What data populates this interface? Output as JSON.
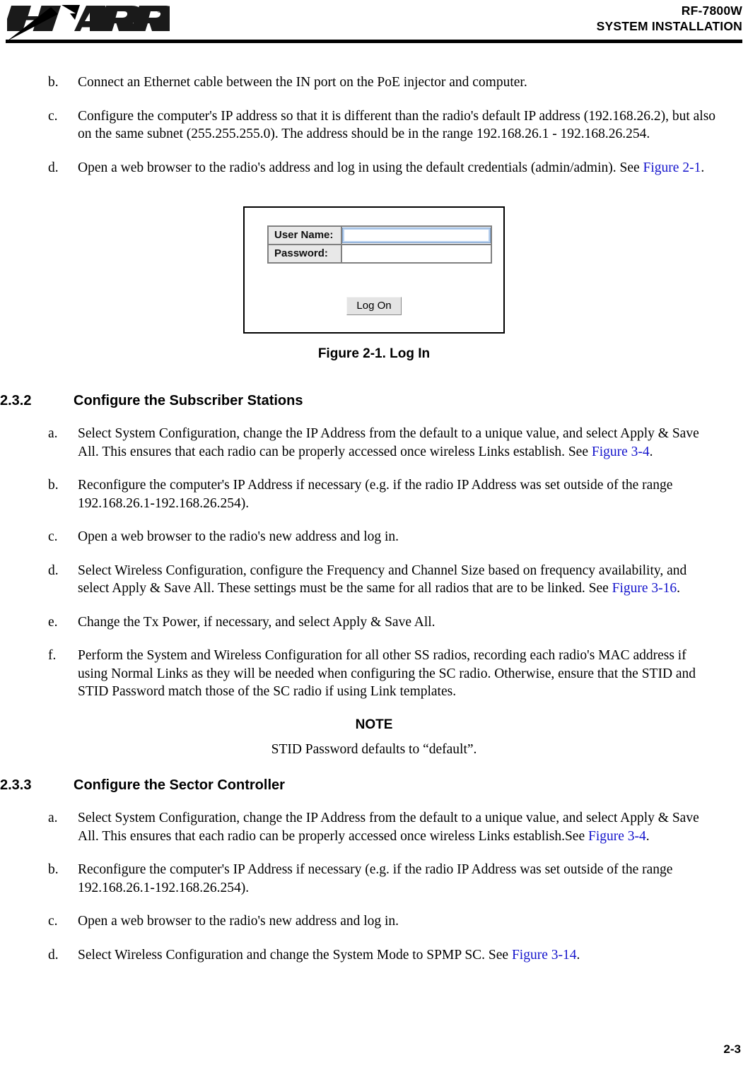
{
  "header": {
    "logo_alt": "HARRIS",
    "logo_text": "HARRIS",
    "registered_mark": "®",
    "product": "RF-7800W",
    "manual_title": "SYSTEM INSTALLATION"
  },
  "steps_top": [
    {
      "marker": "b.",
      "text": "Connect an Ethernet cable between the IN port on the PoE injector and computer."
    },
    {
      "marker": "c.",
      "text": "Configure the computer's IP address so that it is different than the radio's default IP address (192.168.26.2), but also on the same subnet (255.255.255.0). The address should be in the range 192.168.26.1 - 192.168.26.254."
    },
    {
      "marker": "d.",
      "text_before": "Open a web browser to the radio's address and log in using the default credentials (admin/admin). See ",
      "link": "Figure 2-1",
      "text_after": "."
    }
  ],
  "figure": {
    "username_label": "User Name:",
    "password_label": "Password:",
    "username_value": "",
    "password_value": "",
    "logon_label": "Log On",
    "caption": "Figure 2-1.  Log In"
  },
  "section_232": {
    "number": "2.3.2",
    "title": "Configure the Subscriber Stations",
    "items": [
      {
        "marker": "a.",
        "text_before": "Select System Configuration, change the IP Address from the default to a unique value, and select Apply & Save All. This ensures that each radio can be properly accessed once wireless Links establish. See ",
        "link": "Figure 3-4",
        "text_after": "."
      },
      {
        "marker": "b.",
        "text_before": "Reconfigure the computer's IP Address if necessary (e.g. if the radio IP Address was set outside of the range 192.168.26.1-192.168.26.254).",
        "link": "",
        "text_after": ""
      },
      {
        "marker": "c.",
        "text_before": "Open a web browser to the radio's new address and log in.",
        "link": "",
        "text_after": ""
      },
      {
        "marker": "d.",
        "text_before": "Select Wireless Configuration, configure the Frequency and Channel Size based on frequency availability, and select Apply & Save All. These settings must be the same for all radios that are to be linked. See ",
        "link": "Figure 3-16",
        "text_after": "."
      },
      {
        "marker": "e.",
        "text_before": "Change the Tx Power, if necessary, and select Apply & Save All.",
        "link": "",
        "text_after": ""
      },
      {
        "marker": "f.",
        "text_before": "Perform the System and Wireless Configuration for all other SS radios, recording each radio's MAC address if using Normal Links as they will be needed when configuring the SC radio. Otherwise, ensure that the STID and STID Password match those of the SC radio if using Link templates.",
        "link": "",
        "text_after": ""
      }
    ]
  },
  "note": {
    "title": "NOTE",
    "body": "STID Password defaults to “default”."
  },
  "section_233": {
    "number": "2.3.3",
    "title": "Configure the Sector Controller",
    "items": [
      {
        "marker": "a.",
        "text_before": "Select System Configuration, change the IP Address from the default to a unique value, and select Apply & Save All. This ensures that each radio can be properly accessed once wireless Links establish.See ",
        "link": "Figure 3-4",
        "text_after": "."
      },
      {
        "marker": "b.",
        "text_before": "Reconfigure the computer's IP Address if necessary (e.g. if the radio IP Address was set outside of the range 192.168.26.1-192.168.26.254).",
        "link": "",
        "text_after": ""
      },
      {
        "marker": "c.",
        "text_before": "Open a web browser to the radio's new address and log in.",
        "link": "",
        "text_after": ""
      },
      {
        "marker": "d.",
        "text_before": "Select Wireless Configuration and change the System Mode to SPMP SC. See ",
        "link": "Figure 3-14",
        "text_after": "."
      }
    ]
  },
  "footer": {
    "page_number": "2-3"
  },
  "colors": {
    "link": "#1414CC",
    "rule": "#000000",
    "label_bg": "#e8e8e8",
    "focus_border": "#7da2ce"
  }
}
